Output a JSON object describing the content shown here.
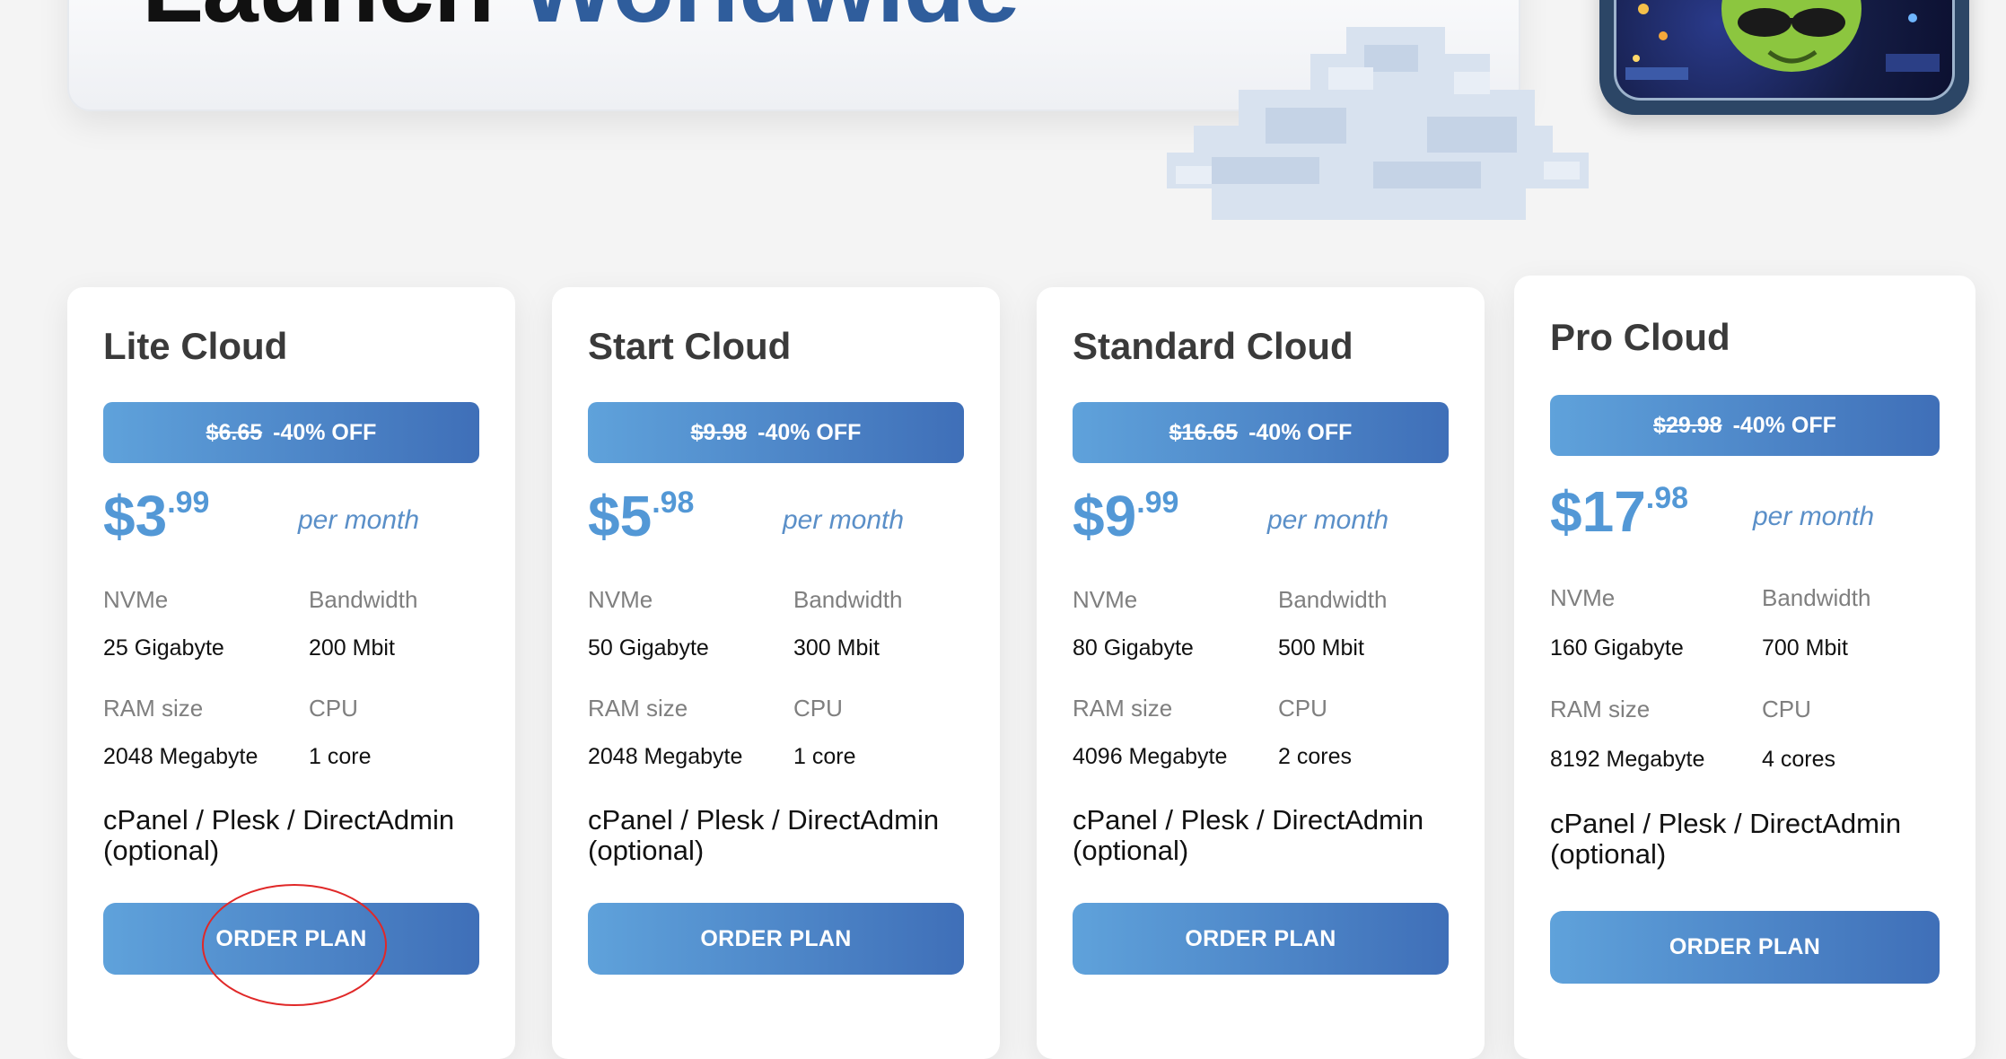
{
  "hero": {
    "title_dark": "Launch",
    "title_accent": "Worldwide"
  },
  "colors": {
    "accent_blue": "#5398d6",
    "gradient_start": "#5fa2db",
    "gradient_end": "#3f6fb8",
    "title_accent": "#2f5d9c"
  },
  "plans": [
    {
      "name": "Lite Cloud",
      "old_price": "$6.65",
      "discount": "-40% OFF",
      "price_dollars": "$3",
      "price_cents": ".99",
      "period": "per month",
      "specs": [
        {
          "label": "NVMe",
          "value": "25 Gigabyte"
        },
        {
          "label": "Bandwidth",
          "value": "200 Mbit"
        },
        {
          "label": "RAM size",
          "value": "2048 Megabyte"
        },
        {
          "label": "CPU",
          "value": "1 core"
        }
      ],
      "panel_note": "cPanel / Plesk / DirectAdmin (optional)",
      "cta": "ORDER PLAN"
    },
    {
      "name": "Start Cloud",
      "old_price": "$9.98",
      "discount": "-40% OFF",
      "price_dollars": "$5",
      "price_cents": ".98",
      "period": "per month",
      "specs": [
        {
          "label": "NVMe",
          "value": "50 Gigabyte"
        },
        {
          "label": "Bandwidth",
          "value": "300 Mbit"
        },
        {
          "label": "RAM size",
          "value": "2048 Megabyte"
        },
        {
          "label": "CPU",
          "value": "1 core"
        }
      ],
      "panel_note": "cPanel / Plesk / DirectAdmin (optional)",
      "cta": "ORDER PLAN"
    },
    {
      "name": "Standard Cloud",
      "old_price": "$16.65",
      "discount": "-40% OFF",
      "price_dollars": "$9",
      "price_cents": ".99",
      "period": "per month",
      "specs": [
        {
          "label": "NVMe",
          "value": "80 Gigabyte"
        },
        {
          "label": "Bandwidth",
          "value": "500 Mbit"
        },
        {
          "label": "RAM size",
          "value": "4096 Megabyte"
        },
        {
          "label": "CPU",
          "value": "2 cores"
        }
      ],
      "panel_note": "cPanel / Plesk / DirectAdmin (optional)",
      "cta": "ORDER PLAN"
    },
    {
      "name": "Pro Cloud",
      "old_price": "$29.98",
      "discount": "-40% OFF",
      "price_dollars": "$17",
      "price_cents": ".98",
      "period": "per month",
      "specs": [
        {
          "label": "NVMe",
          "value": "160 Gigabyte"
        },
        {
          "label": "Bandwidth",
          "value": "700 Mbit"
        },
        {
          "label": "RAM size",
          "value": "8192 Megabyte"
        },
        {
          "label": "CPU",
          "value": "4 cores"
        }
      ],
      "panel_note": "cPanel / Plesk / DirectAdmin (optional)",
      "cta": "ORDER PLAN"
    }
  ]
}
